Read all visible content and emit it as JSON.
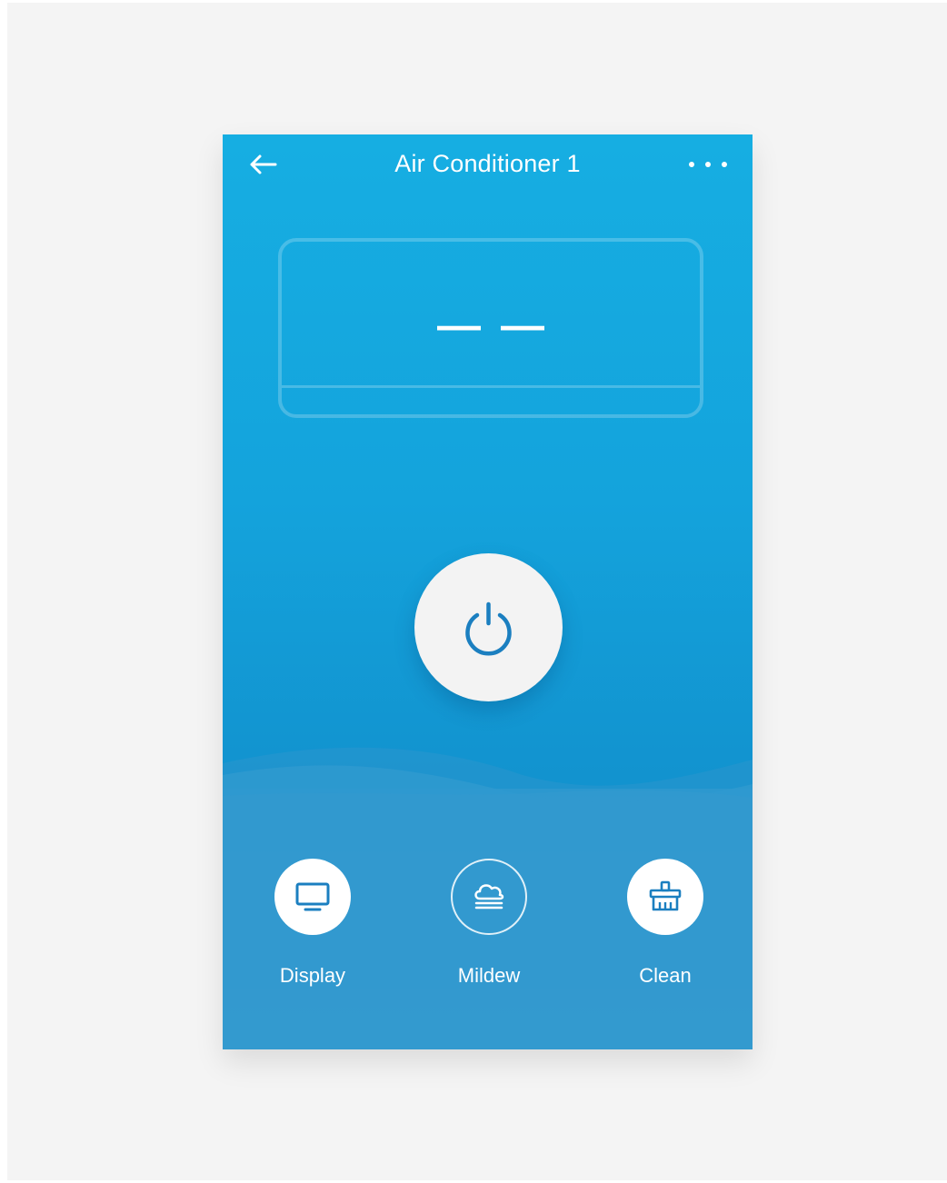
{
  "header": {
    "title": "Air Conditioner 1",
    "back_icon": "arrow-left-icon",
    "more_icon": "more-horizontal-icon"
  },
  "ac_display": {
    "reading": "——"
  },
  "power": {
    "icon": "power-icon"
  },
  "actions": [
    {
      "label": "Display",
      "icon": "monitor-icon",
      "style": "filled"
    },
    {
      "label": "Mildew",
      "icon": "cloud-mildew-icon",
      "style": "outlined"
    },
    {
      "label": "Clean",
      "icon": "brush-icon",
      "style": "filled"
    }
  ],
  "colors": {
    "background": "#f4f4f4",
    "header_top": "#16aee2",
    "accent": "#1b7fc0",
    "button": "#f3f3f3"
  }
}
